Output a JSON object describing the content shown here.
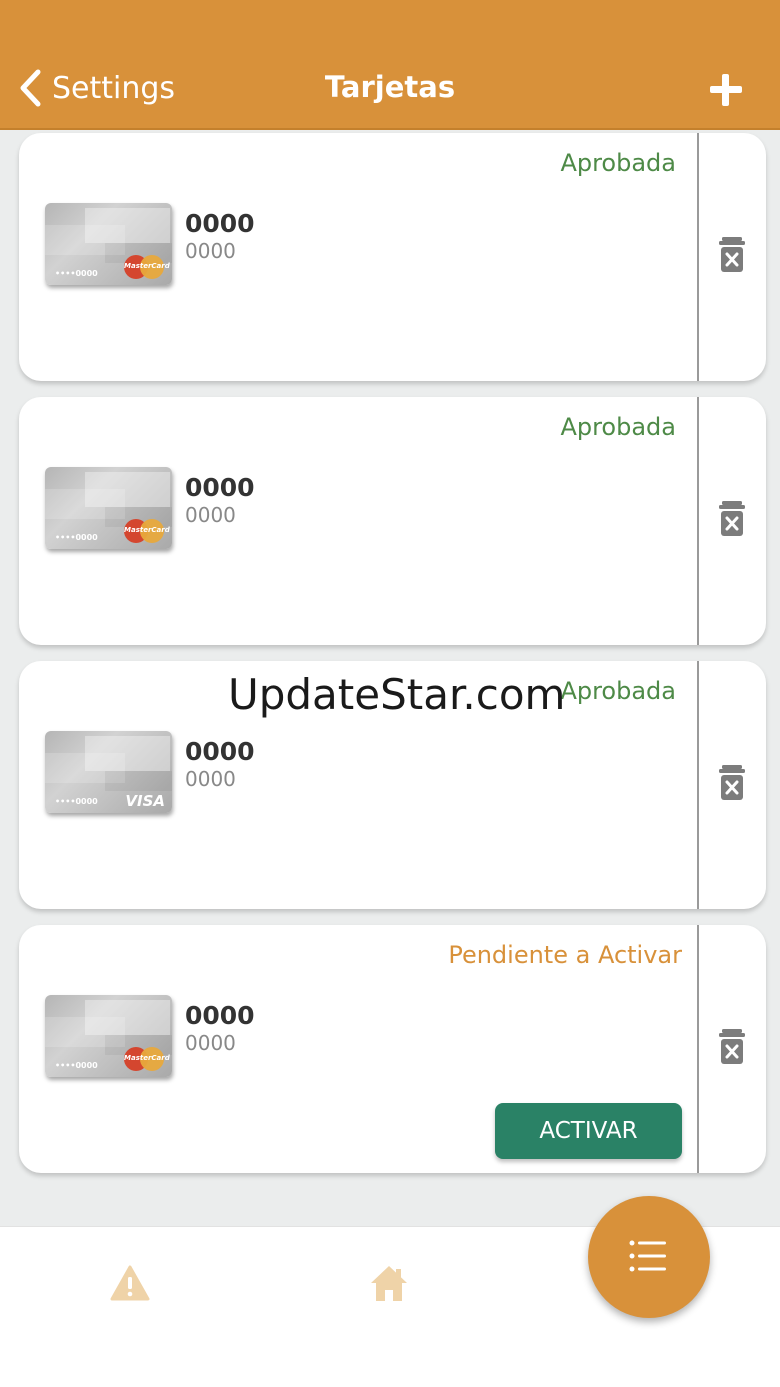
{
  "header": {
    "back_label": "Settings",
    "title": "Tarjetas"
  },
  "colors": {
    "accent": "#d8913a",
    "approved": "#4e8a47",
    "button": "#2a8266"
  },
  "cards": [
    {
      "status": "Aprobada",
      "brand": "MasterCard",
      "card_digits": "••••0000",
      "number": "0000",
      "sub": "0000"
    },
    {
      "status": "Aprobada",
      "brand": "MasterCard",
      "card_digits": "••••0000",
      "number": "0000",
      "sub": "0000"
    },
    {
      "status": "Aprobada",
      "brand": "VISA",
      "card_digits": "••••0000",
      "number": "0000",
      "sub": "0000"
    },
    {
      "status": "Pendiente a Activar",
      "brand": "MasterCard",
      "card_digits": "••••0000",
      "number": "0000",
      "sub": "0000",
      "action": "ACTIVAR"
    }
  ],
  "watermark": "UpdateStar.com",
  "tabs": [
    {
      "icon": "warning-icon"
    },
    {
      "icon": "home-icon"
    },
    {
      "icon": "list-icon"
    }
  ]
}
